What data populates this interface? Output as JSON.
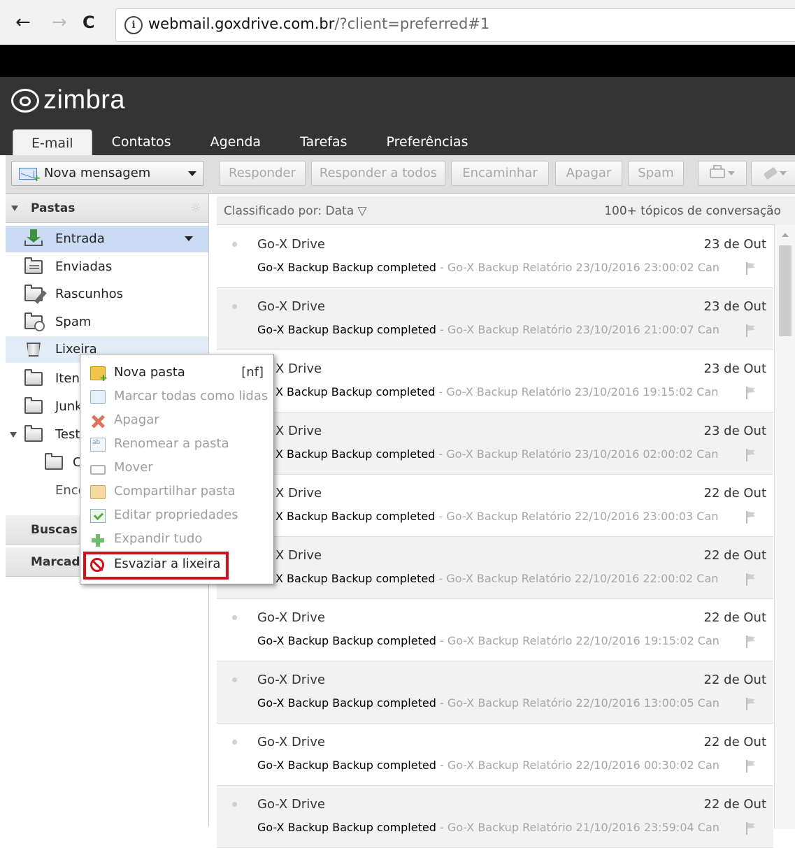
{
  "browser": {
    "back": "←",
    "forward": "→",
    "reload": "C",
    "info": "i",
    "url_host": "webmail.goxdrive.com.br",
    "url_rest": "/?client=preferred#1"
  },
  "app": {
    "logo_text": "zimbra",
    "tabs": [
      {
        "label": "E-mail"
      },
      {
        "label": "Contatos"
      },
      {
        "label": "Agenda"
      },
      {
        "label": "Tarefas"
      },
      {
        "label": "Preferências"
      }
    ]
  },
  "toolbar": {
    "new_message": "Nova mensagem",
    "reply": "Responder",
    "reply_all": "Responder a todos",
    "forward": "Encaminhar",
    "delete": "Apagar",
    "spam": "Spam"
  },
  "sidebar": {
    "folders_title": "Pastas",
    "folders": [
      {
        "label": "Entrada"
      },
      {
        "label": "Enviadas"
      },
      {
        "label": "Rascunhos"
      },
      {
        "label": "Spam"
      },
      {
        "label": "Lixeira"
      },
      {
        "label": "Iten"
      },
      {
        "label": "Junk"
      },
      {
        "label": "Test"
      },
      {
        "label": "C"
      },
      {
        "label": "Enco"
      }
    ],
    "searches_title": "Buscas",
    "tags_title": "Marcad"
  },
  "list": {
    "sort_label": "Classificado por: Data  ▽",
    "count_label": "100+ tópicos de conversação",
    "messages": [
      {
        "from": "Go-X Drive",
        "date": "23 de Out",
        "subject": "Go-X Backup Backup completed",
        "fragment": " - Go-X Backup Relatório 23/10/2016 23:00:02 Can"
      },
      {
        "from": "Go-X Drive",
        "date": "23 de Out",
        "subject": "Go-X Backup Backup completed",
        "fragment": " - Go-X Backup Relatório 23/10/2016 21:00:07 Can"
      },
      {
        "from": "Go-X Drive",
        "date": "23 de Out",
        "subject": "Go-X Backup Backup completed",
        "fragment": " - Go-X Backup Relatório 23/10/2016 19:15:02 Can"
      },
      {
        "from": "Go-X Drive",
        "date": "23 de Out",
        "subject": "Go-X Backup Backup completed",
        "fragment": " - Go-X Backup Relatório 23/10/2016 02:00:02 Can"
      },
      {
        "from": "Go-X Drive",
        "date": "22 de Out",
        "subject": "Go-X Backup Backup completed",
        "fragment": " - Go-X Backup Relatório 22/10/2016 23:00:03 Can"
      },
      {
        "from": "Go-X Drive",
        "date": "22 de Out",
        "subject": "Go-X Backup Backup completed",
        "fragment": " - Go-X Backup Relatório 22/10/2016 22:00:02 Can"
      },
      {
        "from": "Go-X Drive",
        "date": "22 de Out",
        "subject": "Go-X Backup Backup completed",
        "fragment": " - Go-X Backup Relatório 22/10/2016 19:15:02 Can"
      },
      {
        "from": "Go-X Drive",
        "date": "22 de Out",
        "subject": "Go-X Backup Backup completed",
        "fragment": " - Go-X Backup Relatório 22/10/2016 13:00:05 Can"
      },
      {
        "from": "Go-X Drive",
        "date": "22 de Out",
        "subject": "Go-X Backup Backup completed",
        "fragment": " - Go-X Backup Relatório 22/10/2016 00:30:02 Can"
      },
      {
        "from": "Go-X Drive",
        "date": "22 de Out",
        "subject": "Go-X Backup Backup completed",
        "fragment": " - Go-X Backup Relatório 21/10/2016 23:59:04 Can"
      }
    ],
    "partial_from": "X Drive",
    "partial_subject": "X Backup Backup completed"
  },
  "context_menu": {
    "items": [
      {
        "label": "Nova pasta",
        "shortcut": "[nf]",
        "enabled": true,
        "icon": "new-folder-icon"
      },
      {
        "label": "Marcar todas como lidas",
        "enabled": false,
        "icon": "mark-read-icon"
      },
      {
        "label": "Apagar",
        "enabled": false,
        "icon": "delete-icon"
      },
      {
        "label": "Renomear a pasta",
        "enabled": false,
        "icon": "rename-icon"
      },
      {
        "label": "Mover",
        "enabled": false,
        "icon": "move-icon"
      },
      {
        "label": "Compartilhar pasta",
        "enabled": false,
        "icon": "share-folder-icon"
      },
      {
        "label": "Editar propriedades",
        "enabled": false,
        "icon": "edit-properties-icon"
      },
      {
        "label": "Expandir tudo",
        "enabled": false,
        "icon": "expand-all-icon"
      },
      {
        "label": "Esvaziar a lixeira",
        "enabled": true,
        "icon": "empty-trash-icon"
      }
    ]
  },
  "colors": {
    "highlight": "#d3111c",
    "selected_row": "#c9dcf3",
    "header_bg": "#343434"
  }
}
